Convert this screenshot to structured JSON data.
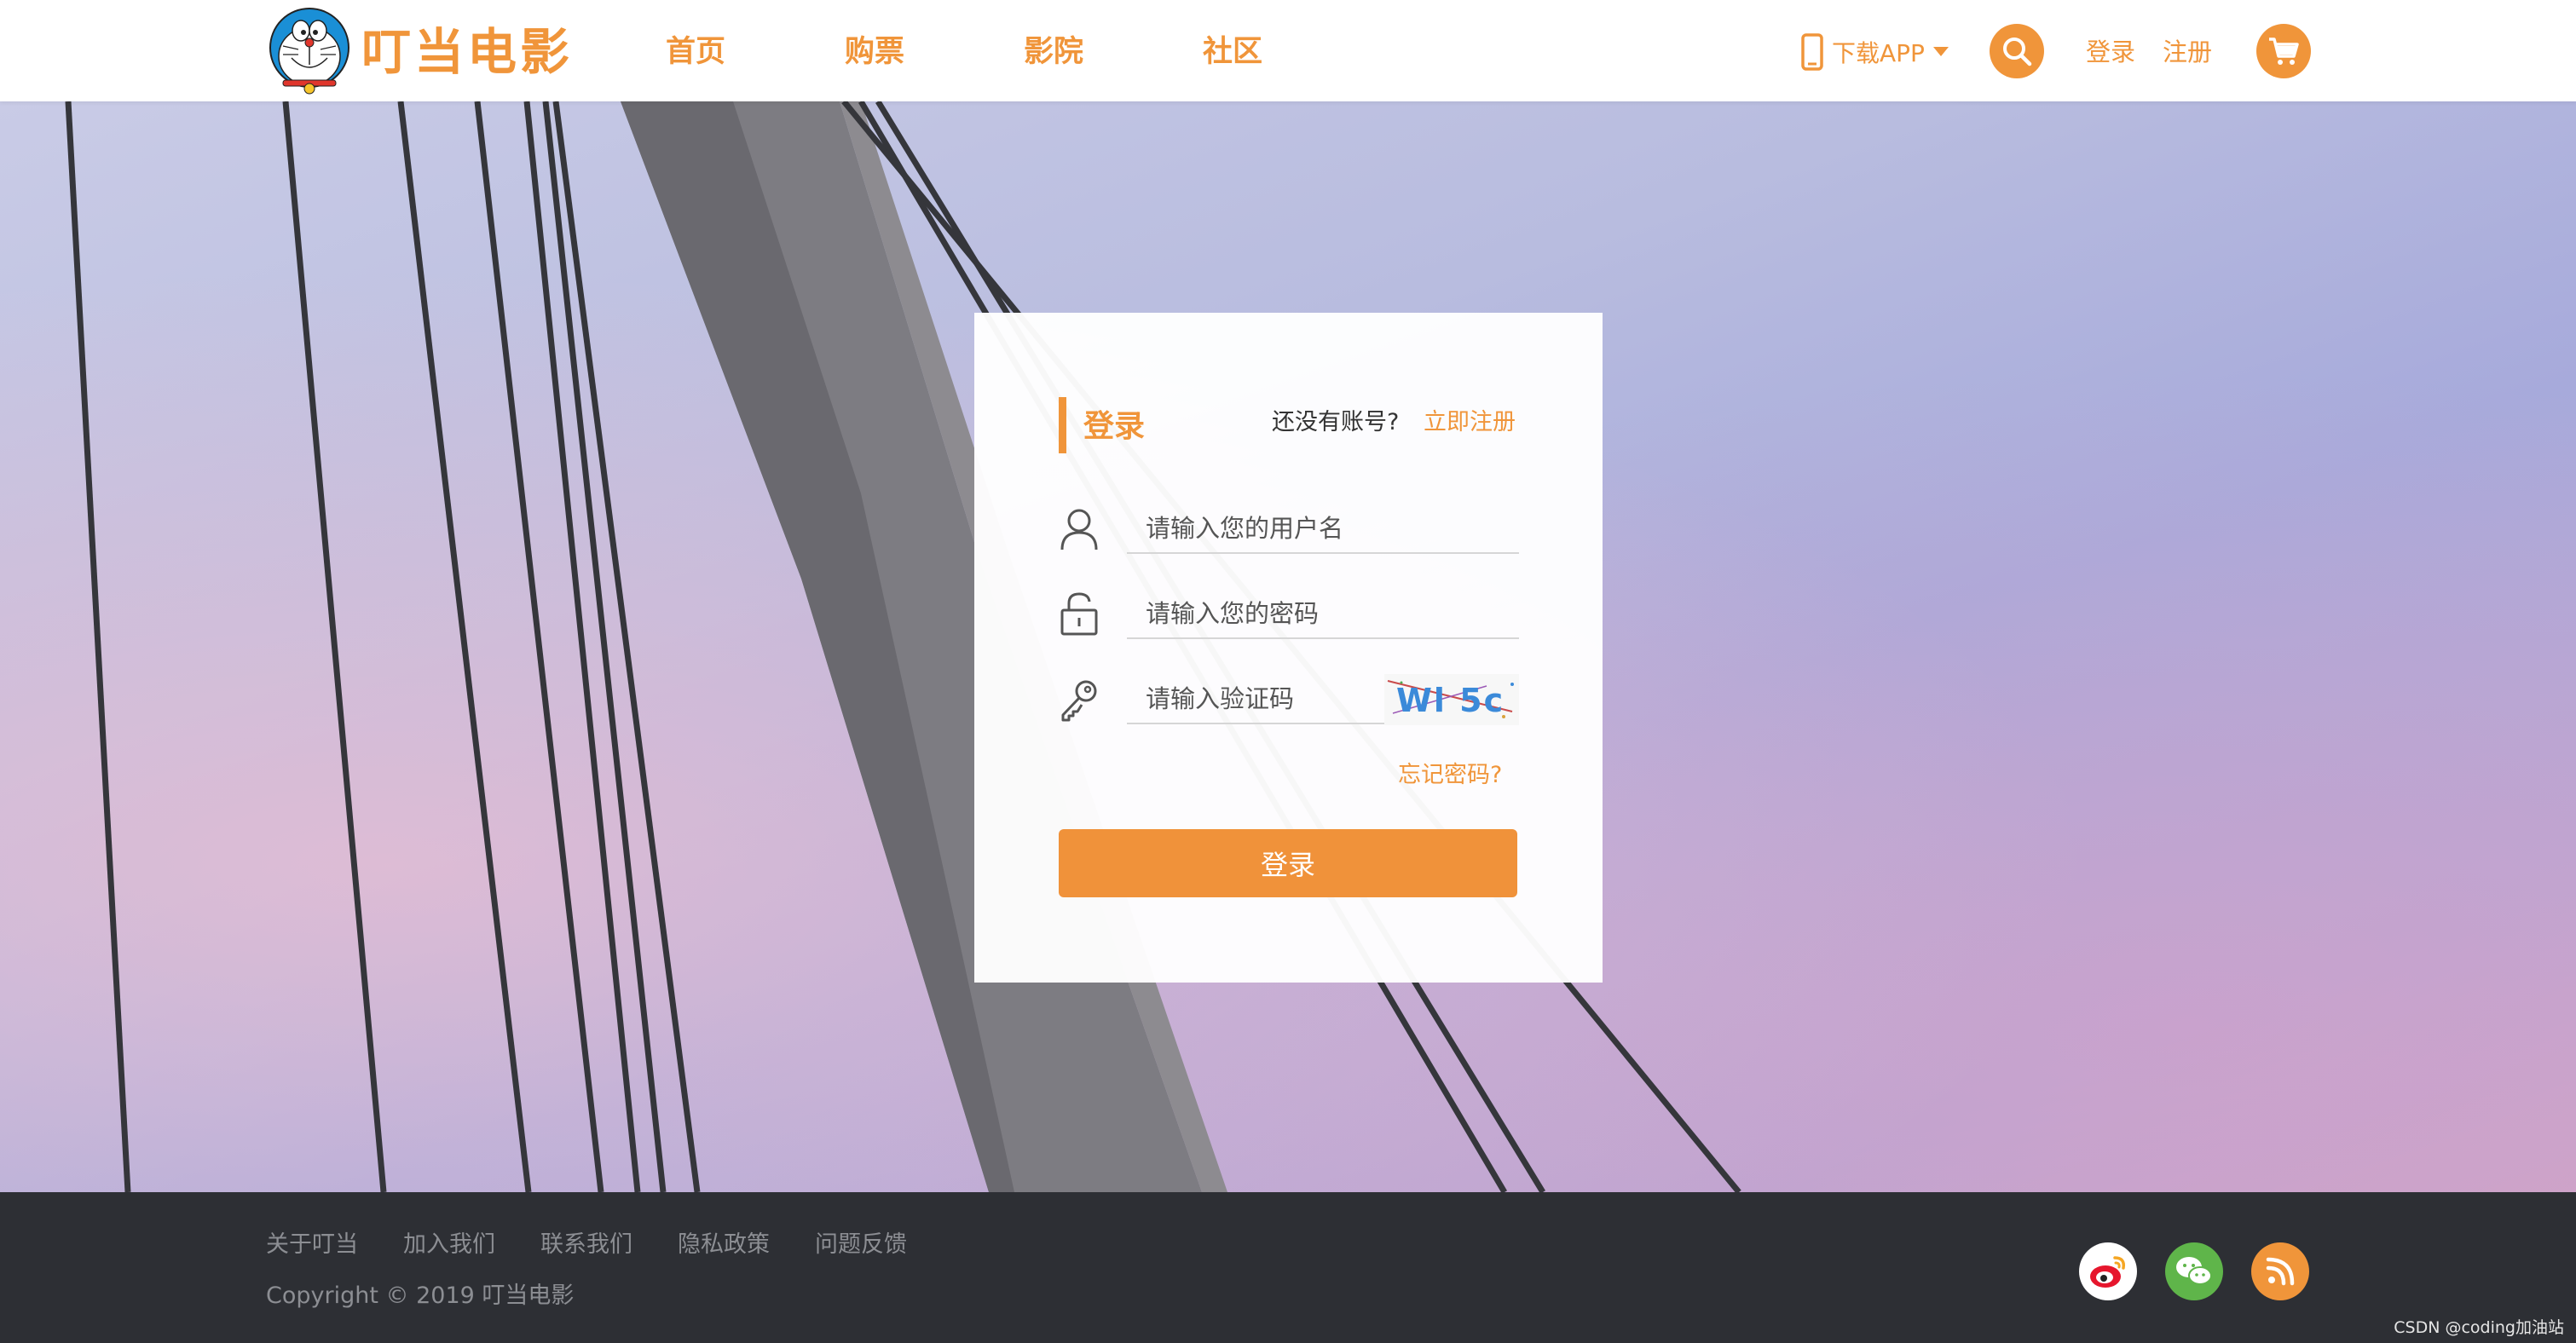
{
  "header": {
    "brand": "叮当电影",
    "nav": [
      "首页",
      "购票",
      "影院",
      "社区"
    ],
    "download_app": "下载APP",
    "login_link": "登录",
    "register_link": "注册"
  },
  "login": {
    "title": "登录",
    "no_account": "还没有账号?",
    "register_now": "立即注册",
    "username_placeholder": "请输入您的用户名",
    "password_placeholder": "请输入您的密码",
    "captcha_placeholder": "请输入验证码",
    "captcha_text": "Wl 5c",
    "forgot_password": "忘记密码?",
    "submit": "登录"
  },
  "footer": {
    "links": [
      "关于叮当",
      "加入我们",
      "联系我们",
      "隐私政策",
      "问题反馈"
    ],
    "copyright": "Copyright © 2019 叮当电影",
    "social": [
      "weibo-icon",
      "wechat-icon",
      "rss-icon"
    ]
  },
  "watermark": "CSDN @coding加油站",
  "colors": {
    "accent": "#f0953a",
    "footer_bg": "#2d2f34",
    "weibo": "#ffffff",
    "wechat": "#5fb54a",
    "rss": "#f0953a"
  }
}
